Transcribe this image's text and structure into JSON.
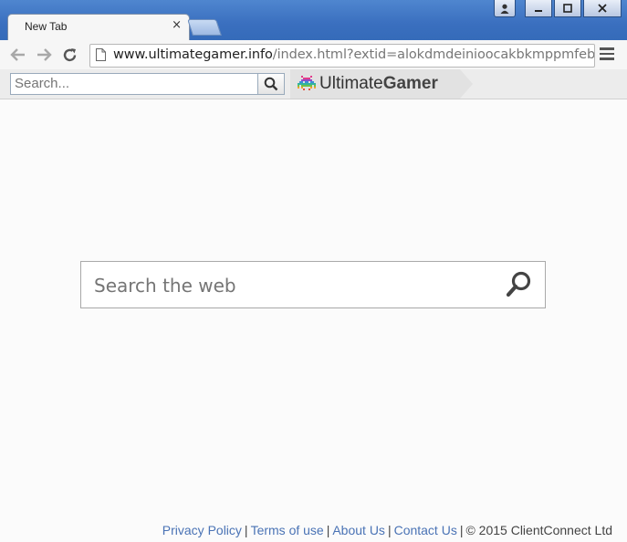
{
  "window": {
    "tab_title": "New Tab",
    "tab_close": "×"
  },
  "toolbar": {
    "url_host": "www.ultimategamer.info",
    "url_path": "/index.html?extid=alokdmdeinioocakbkmppmfebk"
  },
  "extension_bar": {
    "search_placeholder": "Search...",
    "brand_light": "Ultimate",
    "brand_bold": "Gamer"
  },
  "main": {
    "search_placeholder": "Search the web"
  },
  "footer": {
    "links": [
      "Privacy Policy",
      "Terms of use",
      "About Us",
      "Contact Us"
    ],
    "separator": "|",
    "copyright": "© 2015 ClientConnect Ltd"
  },
  "colors": {
    "titlebar": "#3a6fbf",
    "link": "#4a73b5"
  }
}
